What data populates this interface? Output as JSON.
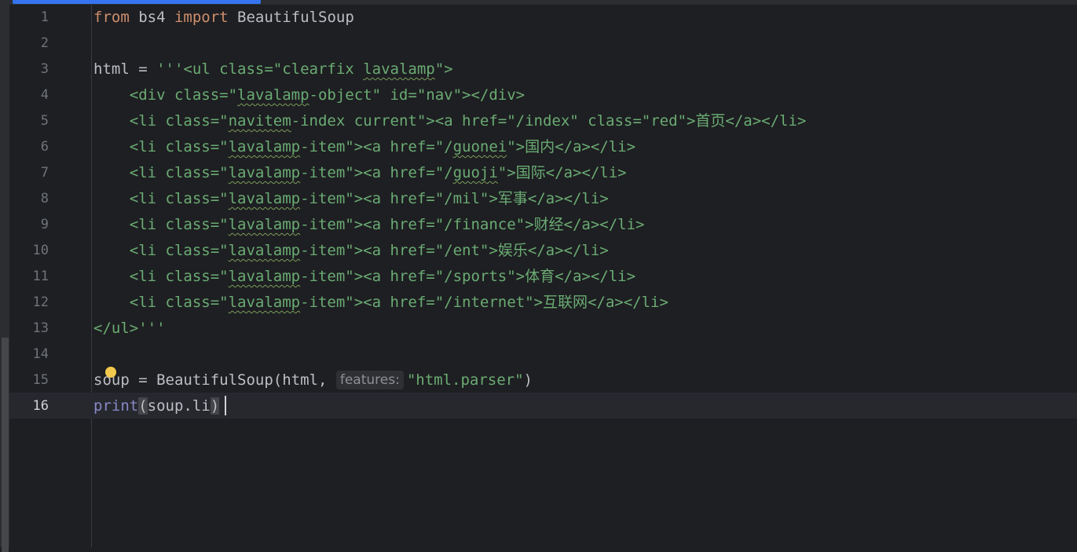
{
  "editor": {
    "current_line": 16,
    "hint_label": "features:",
    "lines": [
      {
        "n": "1",
        "t": [
          "from",
          " bs4 ",
          "import",
          " BeautifulSoup"
        ]
      },
      {
        "n": "2"
      },
      {
        "n": "3",
        "t": [
          "html = ",
          "'''<ul class=\"clearfix ",
          "lavalamp",
          "\">"
        ]
      },
      {
        "n": "4",
        "t": [
          "    <div class=\"",
          "lavalamp",
          "-object\" id=\"nav\"></div>"
        ]
      },
      {
        "n": "5",
        "t": [
          "    <li class=\"",
          "navitem",
          "-index current\"><a href=\"/index\" class=\"red\">首页</a></li>"
        ]
      },
      {
        "n": "6",
        "t": [
          "    <li class=\"",
          "lavalamp",
          "-item\"><a href=\"/",
          "guonei",
          "\">国内</a></li>"
        ]
      },
      {
        "n": "7",
        "t": [
          "    <li class=\"",
          "lavalamp",
          "-item\"><a href=\"/",
          "guoji",
          "\">国际</a></li>"
        ]
      },
      {
        "n": "8",
        "t": [
          "    <li class=\"",
          "lavalamp",
          "-item\"><a href=\"/mil\">军事</a></li>"
        ]
      },
      {
        "n": "9",
        "t": [
          "    <li class=\"",
          "lavalamp",
          "-item\"><a href=\"/finance\">财经</a></li>"
        ]
      },
      {
        "n": "10",
        "t": [
          "    <li class=\"",
          "lavalamp",
          "-item\"><a href=\"/ent\">娱乐</a></li>"
        ]
      },
      {
        "n": "11",
        "t": [
          "    <li class=\"",
          "lavalamp",
          "-item\"><a href=\"/sports\">体育</a></li>"
        ]
      },
      {
        "n": "12",
        "t": [
          "    <li class=\"",
          "lavalamp",
          "-item\"><a href=\"/internet\">互联网</a></li>"
        ]
      },
      {
        "n": "13",
        "t": [
          "</ul>'''"
        ]
      },
      {
        "n": "14"
      },
      {
        "n": "15",
        "t": [
          "soup = BeautifulSoup(html, ",
          "\"html.parser\"",
          ")"
        ]
      },
      {
        "n": "16",
        "t": [
          "print",
          "(",
          "soup.li",
          ")"
        ]
      }
    ]
  }
}
